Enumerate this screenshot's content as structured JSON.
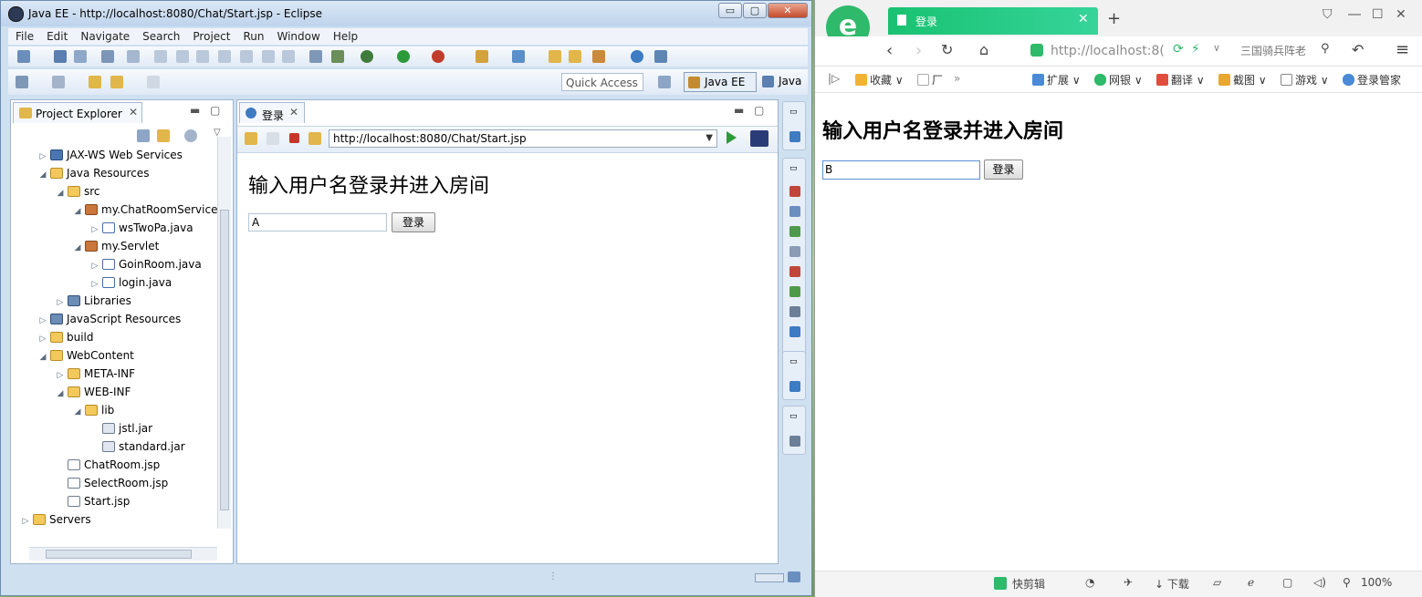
{
  "eclipse": {
    "title": "Java EE - http://localhost:8080/Chat/Start.jsp - Eclipse",
    "window_buttons": [
      "▭",
      "▢",
      "✕"
    ],
    "menu": [
      "File",
      "Edit",
      "Navigate",
      "Search",
      "Project",
      "Run",
      "Window",
      "Help"
    ],
    "quick_access": "Quick Access",
    "perspective_active": "Java EE",
    "perspective_other": "Java",
    "project_explorer": {
      "tab_label": "Project Explorer",
      "items": [
        {
          "label": "JAX-WS Web Services",
          "depth": 1,
          "twisty": "▷",
          "icon": "ic-ws"
        },
        {
          "label": "Java Resources",
          "depth": 1,
          "twisty": "◢",
          "icon": "ic-folder"
        },
        {
          "label": "src",
          "depth": 2,
          "twisty": "◢",
          "icon": "ic-folder"
        },
        {
          "label": "my.ChatRoomService",
          "depth": 3,
          "twisty": "◢",
          "icon": "ic-pkg"
        },
        {
          "label": "wsTwoPa.java",
          "depth": 4,
          "twisty": "▷",
          "icon": "ic-java"
        },
        {
          "label": "my.Servlet",
          "depth": 3,
          "twisty": "◢",
          "icon": "ic-pkg"
        },
        {
          "label": "GoinRoom.java",
          "depth": 4,
          "twisty": "▷",
          "icon": "ic-java"
        },
        {
          "label": "login.java",
          "depth": 4,
          "twisty": "▷",
          "icon": "ic-java"
        },
        {
          "label": "Libraries",
          "depth": 2,
          "twisty": "▷",
          "icon": "ic-lib"
        },
        {
          "label": "JavaScript Resources",
          "depth": 1,
          "twisty": "▷",
          "icon": "ic-lib"
        },
        {
          "label": "build",
          "depth": 1,
          "twisty": "▷",
          "icon": "ic-folder"
        },
        {
          "label": "WebContent",
          "depth": 1,
          "twisty": "◢",
          "icon": "ic-folder"
        },
        {
          "label": "META-INF",
          "depth": 2,
          "twisty": "▷",
          "icon": "ic-folder"
        },
        {
          "label": "WEB-INF",
          "depth": 2,
          "twisty": "◢",
          "icon": "ic-folder"
        },
        {
          "label": "lib",
          "depth": 3,
          "twisty": "◢",
          "icon": "ic-folder"
        },
        {
          "label": "jstl.jar",
          "depth": 4,
          "twisty": "",
          "icon": "ic-jar"
        },
        {
          "label": "standard.jar",
          "depth": 4,
          "twisty": "",
          "icon": "ic-jar"
        },
        {
          "label": "ChatRoom.jsp",
          "depth": 2,
          "twisty": "",
          "icon": "ic-jsp"
        },
        {
          "label": "SelectRoom.jsp",
          "depth": 2,
          "twisty": "",
          "icon": "ic-jsp"
        },
        {
          "label": "Start.jsp",
          "depth": 2,
          "twisty": "",
          "icon": "ic-jsp"
        },
        {
          "label": "Servers",
          "depth": 0,
          "twisty": "▷",
          "icon": "ic-folder"
        }
      ]
    },
    "editor": {
      "tab_label": "登录",
      "url": "http://localhost:8080/Chat/Start.jsp",
      "heading": "输入用户名登录并进入房间",
      "input_value": "A",
      "button_label": "登录"
    }
  },
  "browser": {
    "logo_letter": "e",
    "tab_label": "登录",
    "tab_close": "✕",
    "new_tab": "+",
    "address": "http://localhost:8(",
    "search_text": "三国骑兵阵老",
    "favorites": [
      "收藏",
      "厂",
      "扩展",
      "网银",
      "翻译",
      "截图",
      "游戏",
      "登录管家"
    ],
    "favorites_more": "»",
    "heading": "输入用户名登录并进入房间",
    "input_value": "B",
    "button_label": "登录",
    "status": {
      "quick_clip": "快剪辑",
      "download": "下载",
      "zoom": "100%"
    }
  }
}
